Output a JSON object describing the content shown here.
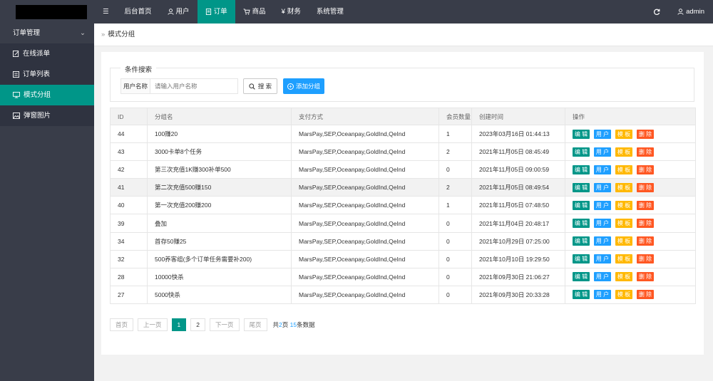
{
  "topbar": {
    "nav": [
      {
        "icon": "menu-icon",
        "label": "☰"
      },
      {
        "label": "后台首页"
      },
      {
        "icon": "user-icon",
        "label": "用户"
      },
      {
        "icon": "document-icon",
        "label": "订单"
      },
      {
        "icon": "cart-icon",
        "label": "商品"
      },
      {
        "icon": "yen-icon",
        "label": "财务"
      },
      {
        "label": "系统管理"
      }
    ],
    "active_index": 3,
    "admin_label": "admin"
  },
  "sidebar": {
    "group_label": "订单管理",
    "items": [
      {
        "label": "在线派单",
        "icon": "edit-icon"
      },
      {
        "label": "订单列表",
        "icon": "list-icon"
      },
      {
        "label": "模式分组",
        "icon": "monitor-icon"
      },
      {
        "label": "弹窗图片",
        "icon": "image-icon"
      }
    ],
    "active_index": 2
  },
  "breadcrumb": {
    "label": "模式分组"
  },
  "search": {
    "legend": "条件搜索",
    "field_label": "用户名称",
    "placeholder": "请输入用户名称",
    "search_button": "搜 索",
    "add_button": "添加分组"
  },
  "table": {
    "headers": [
      "ID",
      "分组名",
      "支付方式",
      "会员数量",
      "创建时间",
      "操作"
    ],
    "rows": [
      {
        "id": "44",
        "name": "100赚20",
        "pay": "MarsPay,SEP,Oceanpay,GoldInd,QeInd",
        "count": "1",
        "created": "2023年03月16日 01:44:13"
      },
      {
        "id": "43",
        "name": "3000卡单8个任务",
        "pay": "MarsPay,SEP,Oceanpay,GoldInd,QeInd",
        "count": "2",
        "created": "2021年11月05日 08:45:49"
      },
      {
        "id": "42",
        "name": "第三次充值1K赚300补单500",
        "pay": "MarsPay,SEP,Oceanpay,GoldInd,QeInd",
        "count": "0",
        "created": "2021年11月05日 09:00:59"
      },
      {
        "id": "41",
        "name": "第二次充值500赚150",
        "pay": "MarsPay,SEP,Oceanpay,GoldInd,QeInd",
        "count": "2",
        "created": "2021年11月05日 08:49:54"
      },
      {
        "id": "40",
        "name": "第一次充值200赚200",
        "pay": "MarsPay,SEP,Oceanpay,GoldInd,QeInd",
        "count": "1",
        "created": "2021年11月05日 07:48:50"
      },
      {
        "id": "39",
        "name": "叠加",
        "pay": "MarsPay,SEP,Oceanpay,GoldInd,QeInd",
        "count": "0",
        "created": "2021年11月04日 20:48:17"
      },
      {
        "id": "34",
        "name": "首存50赚25",
        "pay": "MarsPay,SEP,Oceanpay,GoldInd,QeInd",
        "count": "0",
        "created": "2021年10月29日 07:25:00"
      },
      {
        "id": "32",
        "name": "500养客组(多个订单任务需要补200)",
        "pay": "MarsPay,SEP,Oceanpay,GoldInd,QeInd",
        "count": "0",
        "created": "2021年10月10日 19:29:50"
      },
      {
        "id": "28",
        "name": "10000快杀",
        "pay": "MarsPay,SEP,Oceanpay,GoldInd,QeInd",
        "count": "0",
        "created": "2021年09月30日 21:06:27"
      },
      {
        "id": "27",
        "name": "5000快杀",
        "pay": "MarsPay,SEP,Oceanpay,GoldInd,QeInd",
        "count": "0",
        "created": "2021年09月30日 20:33:28"
      }
    ],
    "highlight_row": 3,
    "actions": {
      "edit": "编 辑",
      "user": "用 户",
      "template": "模 板",
      "delete": "删 除"
    }
  },
  "pager": {
    "first": "首页",
    "prev": "上一页",
    "pages": [
      "1",
      "2"
    ],
    "current": "1",
    "next": "下一页",
    "last": "尾页",
    "info_prefix": "共",
    "page_count": "2",
    "info_mid": "页 ",
    "record_count": "15",
    "info_suffix": "条数据"
  },
  "colors": {
    "sidebar": "#393d49",
    "accent": "#009688",
    "blue": "#1e9fff",
    "yellow": "#ffb800",
    "red": "#ff5722"
  }
}
